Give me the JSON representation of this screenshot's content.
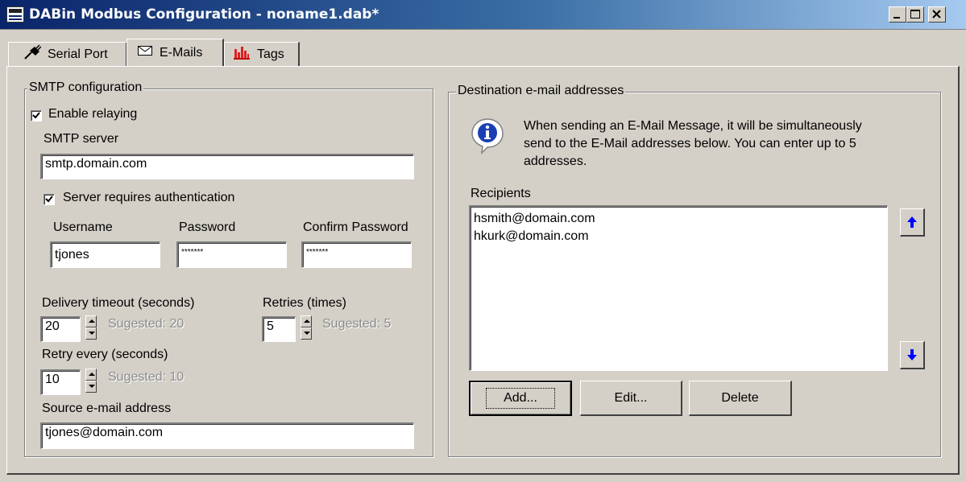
{
  "window": {
    "title": "DABin Modbus Configuration - noname1.dab*"
  },
  "tabs": [
    {
      "label": "Serial Port",
      "icon": "plug-icon"
    },
    {
      "label": "E-Mails",
      "icon": "envelope-icon"
    },
    {
      "label": "Tags",
      "icon": "bar-chart-icon"
    }
  ],
  "active_tab": "E-Mails",
  "smtp": {
    "legend": "SMTP configuration",
    "enable_relaying_label": "Enable relaying",
    "enable_relaying_checked": true,
    "server_label": "SMTP server",
    "server_value": "smtp.domain.com",
    "auth_label": "Server requires authentication",
    "auth_checked": true,
    "username_label": "Username",
    "username_value": "tjones",
    "password_label": "Password",
    "password_value": "*******",
    "confirm_label": "Confirm Password",
    "confirm_value": "*******",
    "timeout_label": "Delivery timeout (seconds)",
    "timeout_value": "20",
    "timeout_suggested": "Sugested: 20",
    "retries_label": "Retries (times)",
    "retries_value": "5",
    "retries_suggested": "Sugested: 5",
    "retry_every_label": "Retry every (seconds)",
    "retry_every_value": "10",
    "retry_every_suggested": "Sugested: 10",
    "source_label": "Source e-mail address",
    "source_value": "tjones@domain.com"
  },
  "destination": {
    "legend": "Destination e-mail addresses",
    "info_line1": "When sending an E-Mail Message, it will be simultaneously",
    "info_line2": "send to the E-Mail addresses below. You can enter up to 5",
    "info_line3": "addresses.",
    "recipients_label": "Recipients",
    "recipients": [
      "hsmith@domain.com",
      "hkurk@domain.com"
    ],
    "add_label": "Add...",
    "edit_label": "Edit...",
    "delete_label": "Delete"
  }
}
